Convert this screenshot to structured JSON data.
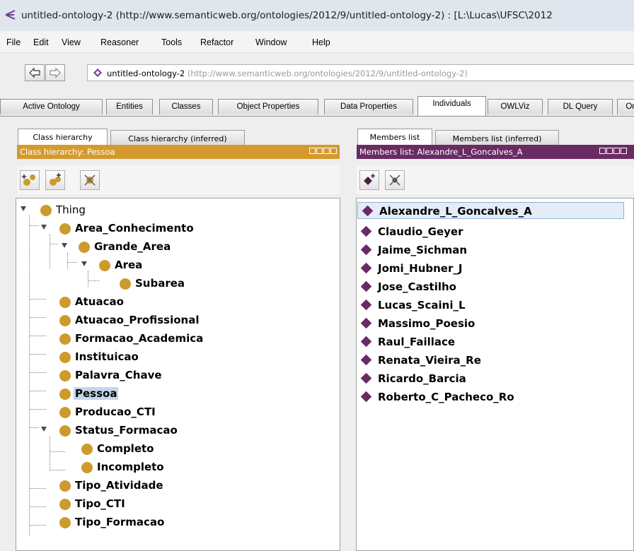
{
  "window": {
    "title": "untitled-ontology-2 (http://www.semanticweb.org/ontologies/2012/9/untitled-ontology-2) : [L:\\Lucas\\UFSC\\2012"
  },
  "menu": [
    "File",
    "Edit",
    "View",
    "Reasoner",
    "Tools",
    "Refactor",
    "Window",
    "Help"
  ],
  "nav": {
    "ontology_name": "untitled-ontology-2",
    "ontology_iri": "(http://www.semanticweb.org/ontologies/2012/9/untitled-ontology-2)"
  },
  "tabs": [
    "Active Ontology",
    "Entities",
    "Classes",
    "Object Properties",
    "Data Properties",
    "Individuals",
    "OWLViz",
    "DL Query",
    "On"
  ],
  "active_tab": "Individuals",
  "left_panel": {
    "subtabs": [
      "Class hierarchy",
      "Class hierarchy (inferred)"
    ],
    "header": "Class hierarchy: Pessoa",
    "header_color": "#d49a2e",
    "tree": [
      {
        "label": "Thing"
      },
      {
        "label": "Area_Conhecimento"
      },
      {
        "label": "Grande_Area"
      },
      {
        "label": "Area"
      },
      {
        "label": "Subarea"
      },
      {
        "label": "Atuacao"
      },
      {
        "label": "Atuacao_Profissional"
      },
      {
        "label": "Formacao_Academica"
      },
      {
        "label": "Instituicao"
      },
      {
        "label": "Palavra_Chave"
      },
      {
        "label": "Pessoa"
      },
      {
        "label": "Producao_CTI"
      },
      {
        "label": "Status_Formacao"
      },
      {
        "label": "Completo"
      },
      {
        "label": "Incompleto"
      },
      {
        "label": "Tipo_Atividade"
      },
      {
        "label": "Tipo_CTI"
      },
      {
        "label": "Tipo_Formacao"
      }
    ],
    "selected": "Pessoa"
  },
  "right_panel": {
    "subtabs": [
      "Members list",
      "Members list (inferred)"
    ],
    "header": "Members list: Alexandre_L_Goncalves_A",
    "header_color": "#6a2a62",
    "members": [
      "Alexandre_L_Goncalves_A",
      "Claudio_Geyer",
      "Jaime_Sichman",
      "Jomi_Hubner_J",
      "Jose_Castilho",
      "Lucas_Scaini_L",
      "Massimo_Poesio",
      "Raul_Faillace",
      "Renata_Vieira_Re",
      "Ricardo_Barcia",
      "Roberto_C_Pacheco_Ro"
    ],
    "selected": "Alexandre_L_Goncalves_A"
  },
  "icons": [
    "protege-icon",
    "back-arrow-icon",
    "forward-arrow-icon",
    "ontology-diamond-icon",
    "add-subclass-icon",
    "add-sibling-class-icon",
    "delete-class-icon",
    "add-individual-icon",
    "delete-individual-icon"
  ]
}
